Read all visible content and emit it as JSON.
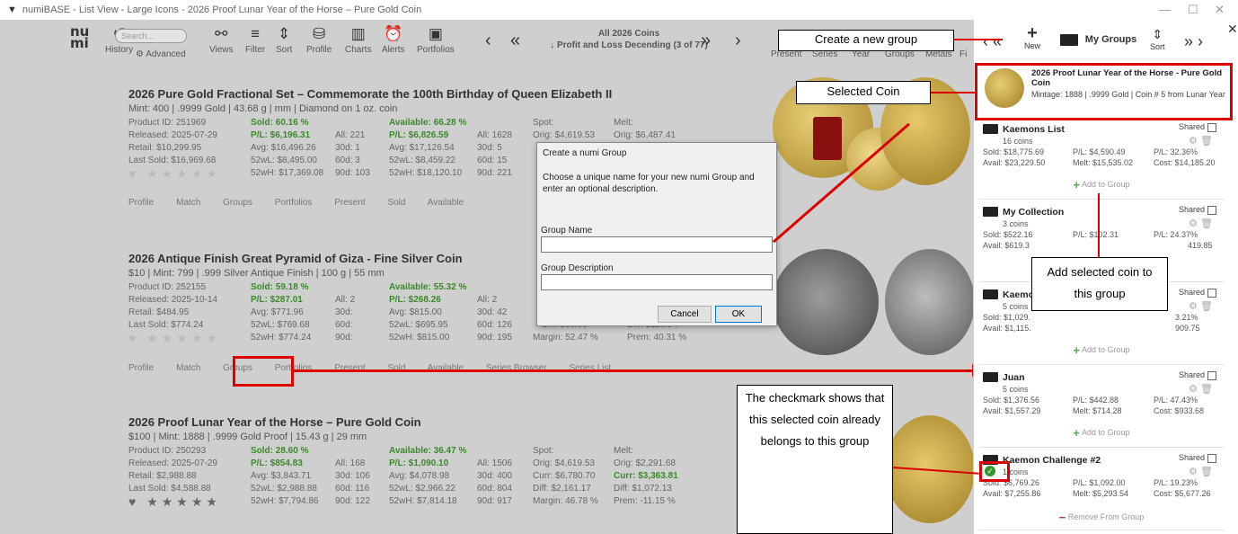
{
  "window": {
    "title": "numiBASE - List View - Large Icons - 2026 Proof Lunar Year of the Horse – Pure Gold Coin"
  },
  "toolbar": {
    "logo": "nu mi",
    "search_placeholder": "Search...",
    "items": [
      "History",
      "Advanced",
      "Views",
      "Filter",
      "Sort",
      "Profile",
      "Charts",
      "Alerts",
      "Portfolios"
    ],
    "list_title": "All 2026 Coins",
    "list_subtitle": "↓ Profit and Loss Decending (3 of 77)",
    "right_tabs": [
      "Present",
      "Series",
      "Year",
      "Groups",
      "Metals",
      "Fi"
    ]
  },
  "coins": [
    {
      "title": "2026  Pure Gold Fractional Set – Commemorate the 100th Birthday of Queen Elizabeth II",
      "sub": "Mint: 400 | .9999 Gold | 43.68 g | mm | Diamond on 1 oz. coin",
      "product_id": "Product ID: 251969",
      "released": "Released: 2025-07-29",
      "retail": "Retail: $10,299.95",
      "last_sold": "Last Sold: $16,969.68",
      "sold": "Sold: 60.16 %",
      "pl": "P/L: $6,196.31",
      "avg": "Avg: $16,496.26",
      "w52": "52wL: $8,495.00",
      "wh52": "52wH: $17,369.08",
      "all": "All: 221",
      "d30": "30d: 1",
      "d60": "60d: 3",
      "d90": "90d: 103",
      "available": "Available: 66.28 %",
      "apl": "P/L: $6,826.59",
      "aavg": "Avg: $17,126.54",
      "aw52": "52wL: $8,459.22",
      "awh52": "52wH: $18,120.10",
      "aall": "All: 1628",
      "ad30": "30d: 5",
      "ad60": "60d: 15",
      "ad90": "90d: 221",
      "spot": "Spot:",
      "spot1": "Orig: $4,619.53",
      "melt": "Melt:",
      "melt1": "Orig: $6,487.41"
    },
    {
      "title": "2026 Antique Finish Great Pyramid of Giza - Fine Silver Coin",
      "sub": "$10 | Mint: 799 | .999 Silver Antique Finish | 100 g | 55 mm",
      "product_id": "Product ID: 252155",
      "released": "Released: 2025-10-14",
      "retail": "Retail: $484.95",
      "last_sold": "Last Sold: $774.24",
      "sold": "Sold: 59.18 %",
      "pl": "P/L: $287.01",
      "avg": "Avg: $771.96",
      "w52": "52wL: $769.68",
      "wh52": "52wH: $774.24",
      "all": "All: 2",
      "d30": "30d:",
      "d60": "60d:",
      "d90": "90d:",
      "available": "Available: 55.32 %",
      "apl": "P/L: $268.26",
      "aavg": "Avg: $815.00",
      "aw52": "52wL: $695.95",
      "awh52": "52wH: $815.00",
      "aall": "All: 2",
      "ad30": "30d: 42",
      "ad60": "60d: 126",
      "ad90": "90d: 195",
      "diff1": "Diff: $36.99",
      "diff2": "Diff: $118.94",
      "margin": "Margin: 52.47 %",
      "prem": "Prem: 40.31 %"
    },
    {
      "title": "2026 Proof Lunar Year of the Horse – Pure Gold Coin",
      "sub": "$100 | Mint: 1888 | .9999 Gold Proof | 15.43 g | 29 mm",
      "product_id": "Product ID: 250293",
      "released": "Released: 2025-07-29",
      "retail": "Retail: $2,988.88",
      "last_sold": "Last Sold: $4,588.88",
      "sold": "Sold: 28.60 %",
      "pl": "P/L: $854.83",
      "avg": "Avg: $3,843.71",
      "w52": "52wL: $2,988.88",
      "wh52": "52wH: $7,794.86",
      "all": "All: 168",
      "d30": "30d: 106",
      "d60": "60d: 116",
      "d90": "90d: 122",
      "available": "Available: 36.47 %",
      "apl": "P/L: $1,090.10",
      "aavg": "Avg: $4,078.98",
      "aw52": "52wL: $2,966.22",
      "awh52": "52wH: $7,814.18",
      "aall": "All: 1506",
      "ad30": "30d: 400",
      "ad60": "60d: 804",
      "ad90": "90d: 917",
      "spot": "Spot:",
      "spot1": "Orig: $4,619.53",
      "spot2": "Curr: $6,780.70",
      "spot3": "Diff: $2,161.17",
      "spot4": "Margin: 46.78 %",
      "melt": "Melt:",
      "melt1": "Orig: $2,291.68",
      "melt2": "Curr: $3,363.81",
      "melt3": "Diff: $1,072.13",
      "melt4": "Prem: -11.15 %"
    }
  ],
  "actions": [
    "Profile",
    "Match",
    "Groups",
    "Portfolios",
    "Present",
    "Sold",
    "Available",
    "Series Browser",
    "Series List"
  ],
  "dialog": {
    "title": "Create a numi Group",
    "desc": "Choose a unique name for your new numi Group and enter an optional description.",
    "name_label": "Group Name",
    "desc_label": "Group Description",
    "cancel": "Cancel",
    "ok": "OK"
  },
  "panel": {
    "new_label": "New",
    "groups_label": "My Groups",
    "sort_label": "Sort",
    "selected": {
      "title": "2026 Proof Lunar Year of the Horse - Pure Gold Coin",
      "meta": "Mintage: 1888  |  .9999 Gold | Coin # 5 from Lunar Year"
    },
    "shared_label": "Shared",
    "add_label": "Add to Group",
    "remove_label": "Remove From Group",
    "groups": [
      {
        "name": "Kaemons List",
        "count": "16 coins",
        "sold": "Sold: $18,775.69",
        "pl": "P/L: $4,590.49",
        "plp": "P/L: 32.36%",
        "avail": "Avail: $23,229.50",
        "melt": "Melt: $15,535.02",
        "cost": "Cost: $14,185.20"
      },
      {
        "name": "My Collection",
        "count": "3 coins",
        "sold": "Sold: $522.16",
        "pl": "P/L: $102.31",
        "plp": "P/L: 24.37%",
        "avail": "Avail: $619.3",
        "melt": "",
        "cost": "419.85"
      },
      {
        "name": "Kaemo",
        "count": "5 coins",
        "sold": "Sold: $1,029.",
        "pl": "",
        "plp": "3.21%",
        "avail": "Avail: $1,115.",
        "melt": "",
        "cost": "909.75"
      },
      {
        "name": "Juan",
        "count": "5 coins",
        "sold": "Sold: $1,376.56",
        "pl": "P/L: $442.88",
        "plp": "P/L: 47.43%",
        "avail": "Avail: $1,557.29",
        "melt": "Melt: $714.28",
        "cost": "Cost: $933.68"
      },
      {
        "name": "Kaemon Challenge #2",
        "count": "1 coins",
        "sold": "Sold: $6,769.26",
        "pl": "P/L: $1,092.00",
        "plp": "P/L: 19.23%",
        "avail": "Avail: $7,255.86",
        "melt": "Melt: $5,293.54",
        "cost": "Cost: $5,677.26"
      }
    ]
  },
  "callouts": {
    "create": "Create a new group",
    "selected": "Selected Coin",
    "add": "Add selected coin to this group",
    "check": "The checkmark shows that this selected coin already belongs to this group"
  },
  "colors": {
    "accent_red": "#dd0000",
    "green": "#3a8a2a"
  }
}
